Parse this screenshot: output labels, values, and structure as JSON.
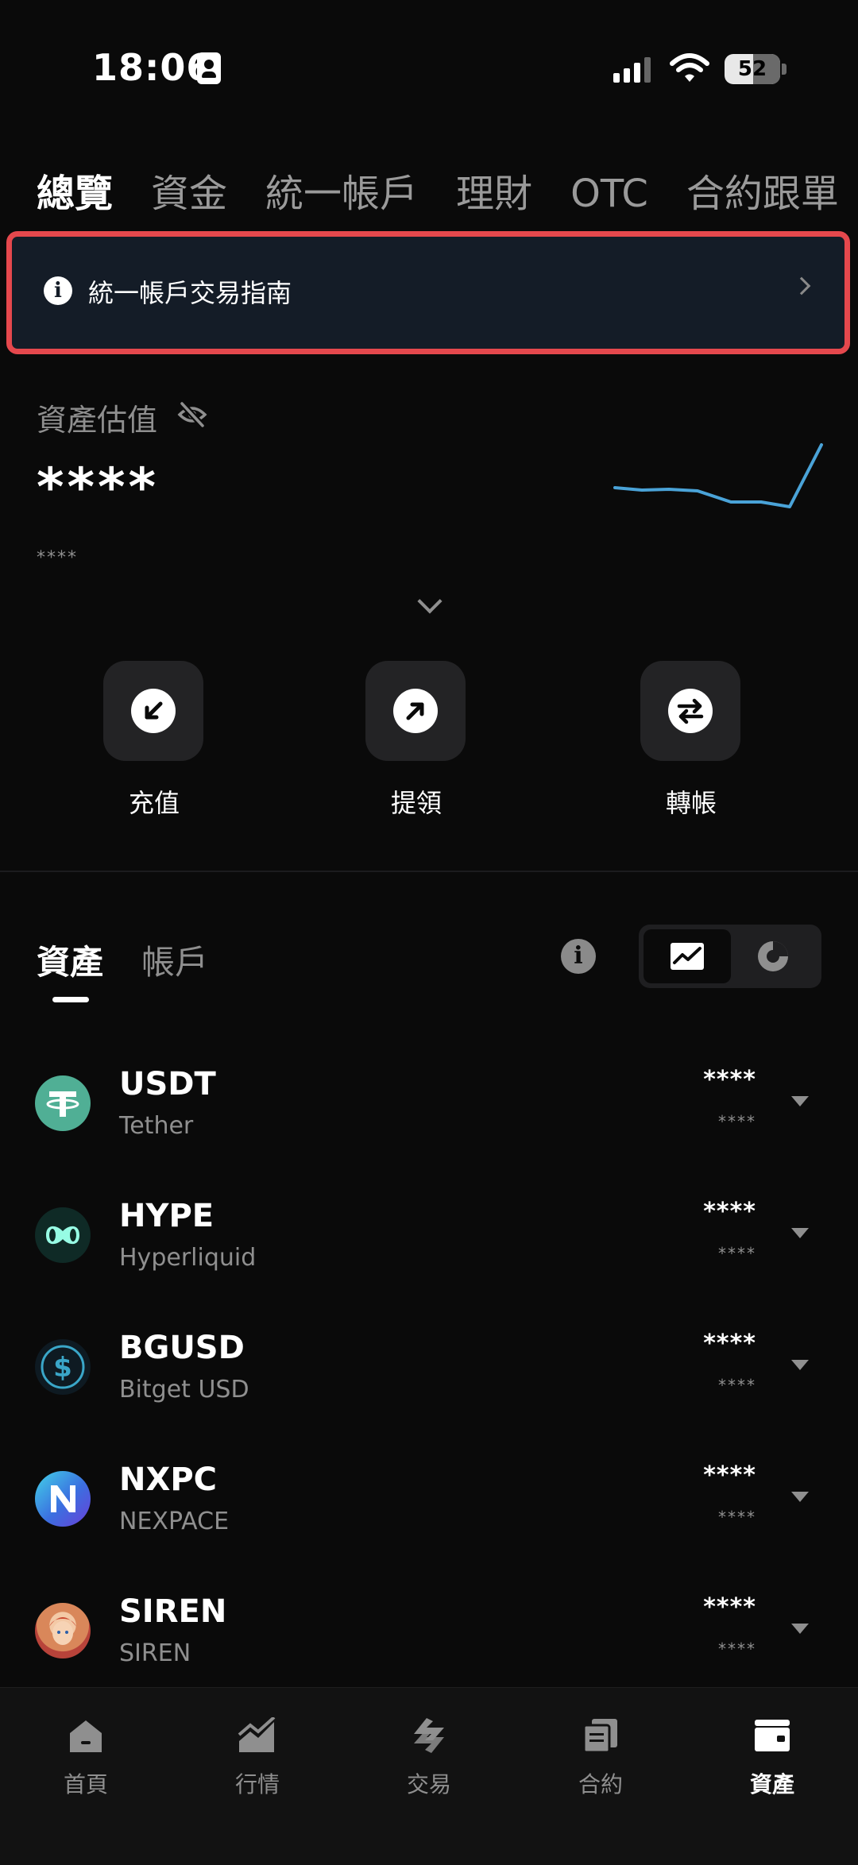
{
  "status_bar": {
    "time": "18:06",
    "battery": "52"
  },
  "top_tabs": [
    {
      "label": "總覽",
      "active": true
    },
    {
      "label": "資金",
      "active": false
    },
    {
      "label": "統一帳戶",
      "active": false
    },
    {
      "label": "理財",
      "active": false
    },
    {
      "label": "OTC",
      "active": false
    },
    {
      "label": "合約跟單",
      "active": false
    }
  ],
  "banner": {
    "text": "統一帳戶交易指南",
    "icon": "info-icon",
    "highlight_color": "#e5484d"
  },
  "valuation": {
    "label": "資產估值",
    "amount": "****",
    "sub_amount": "****",
    "hide_icon": "eye-off-icon",
    "sparkline_color": "#4aa3d8"
  },
  "actions": [
    {
      "label": "充值",
      "icon": "deposit-arrow-icon"
    },
    {
      "label": "提領",
      "icon": "withdraw-arrow-icon"
    },
    {
      "label": "轉帳",
      "icon": "transfer-arrows-icon"
    }
  ],
  "asset_tabs": [
    {
      "label": "資產",
      "active": true
    },
    {
      "label": "帳戶",
      "active": false
    }
  ],
  "assets": [
    {
      "symbol": "USDT",
      "name": "Tether",
      "amount": "****",
      "value": "****",
      "icon_color": "#50af95"
    },
    {
      "symbol": "HYPE",
      "name": "Hyperliquid",
      "amount": "****",
      "value": "****",
      "icon_color": "#0f2a26"
    },
    {
      "symbol": "BGUSD",
      "name": "Bitget USD",
      "amount": "****",
      "value": "****",
      "icon_color": "#0e1a22"
    },
    {
      "symbol": "NXPC",
      "name": "NEXPACE",
      "amount": "****",
      "value": "****",
      "icon_color": "#3b7be0"
    },
    {
      "symbol": "SIREN",
      "name": "SIREN",
      "amount": "****",
      "value": "****",
      "icon_color": "#d9875a"
    }
  ],
  "bottom_nav": [
    {
      "label": "首頁",
      "icon": "home-icon",
      "active": false
    },
    {
      "label": "行情",
      "icon": "chart-icon",
      "active": false
    },
    {
      "label": "交易",
      "icon": "trade-icon",
      "active": false
    },
    {
      "label": "合約",
      "icon": "contract-icon",
      "active": false
    },
    {
      "label": "資產",
      "icon": "wallet-icon",
      "active": true
    }
  ]
}
